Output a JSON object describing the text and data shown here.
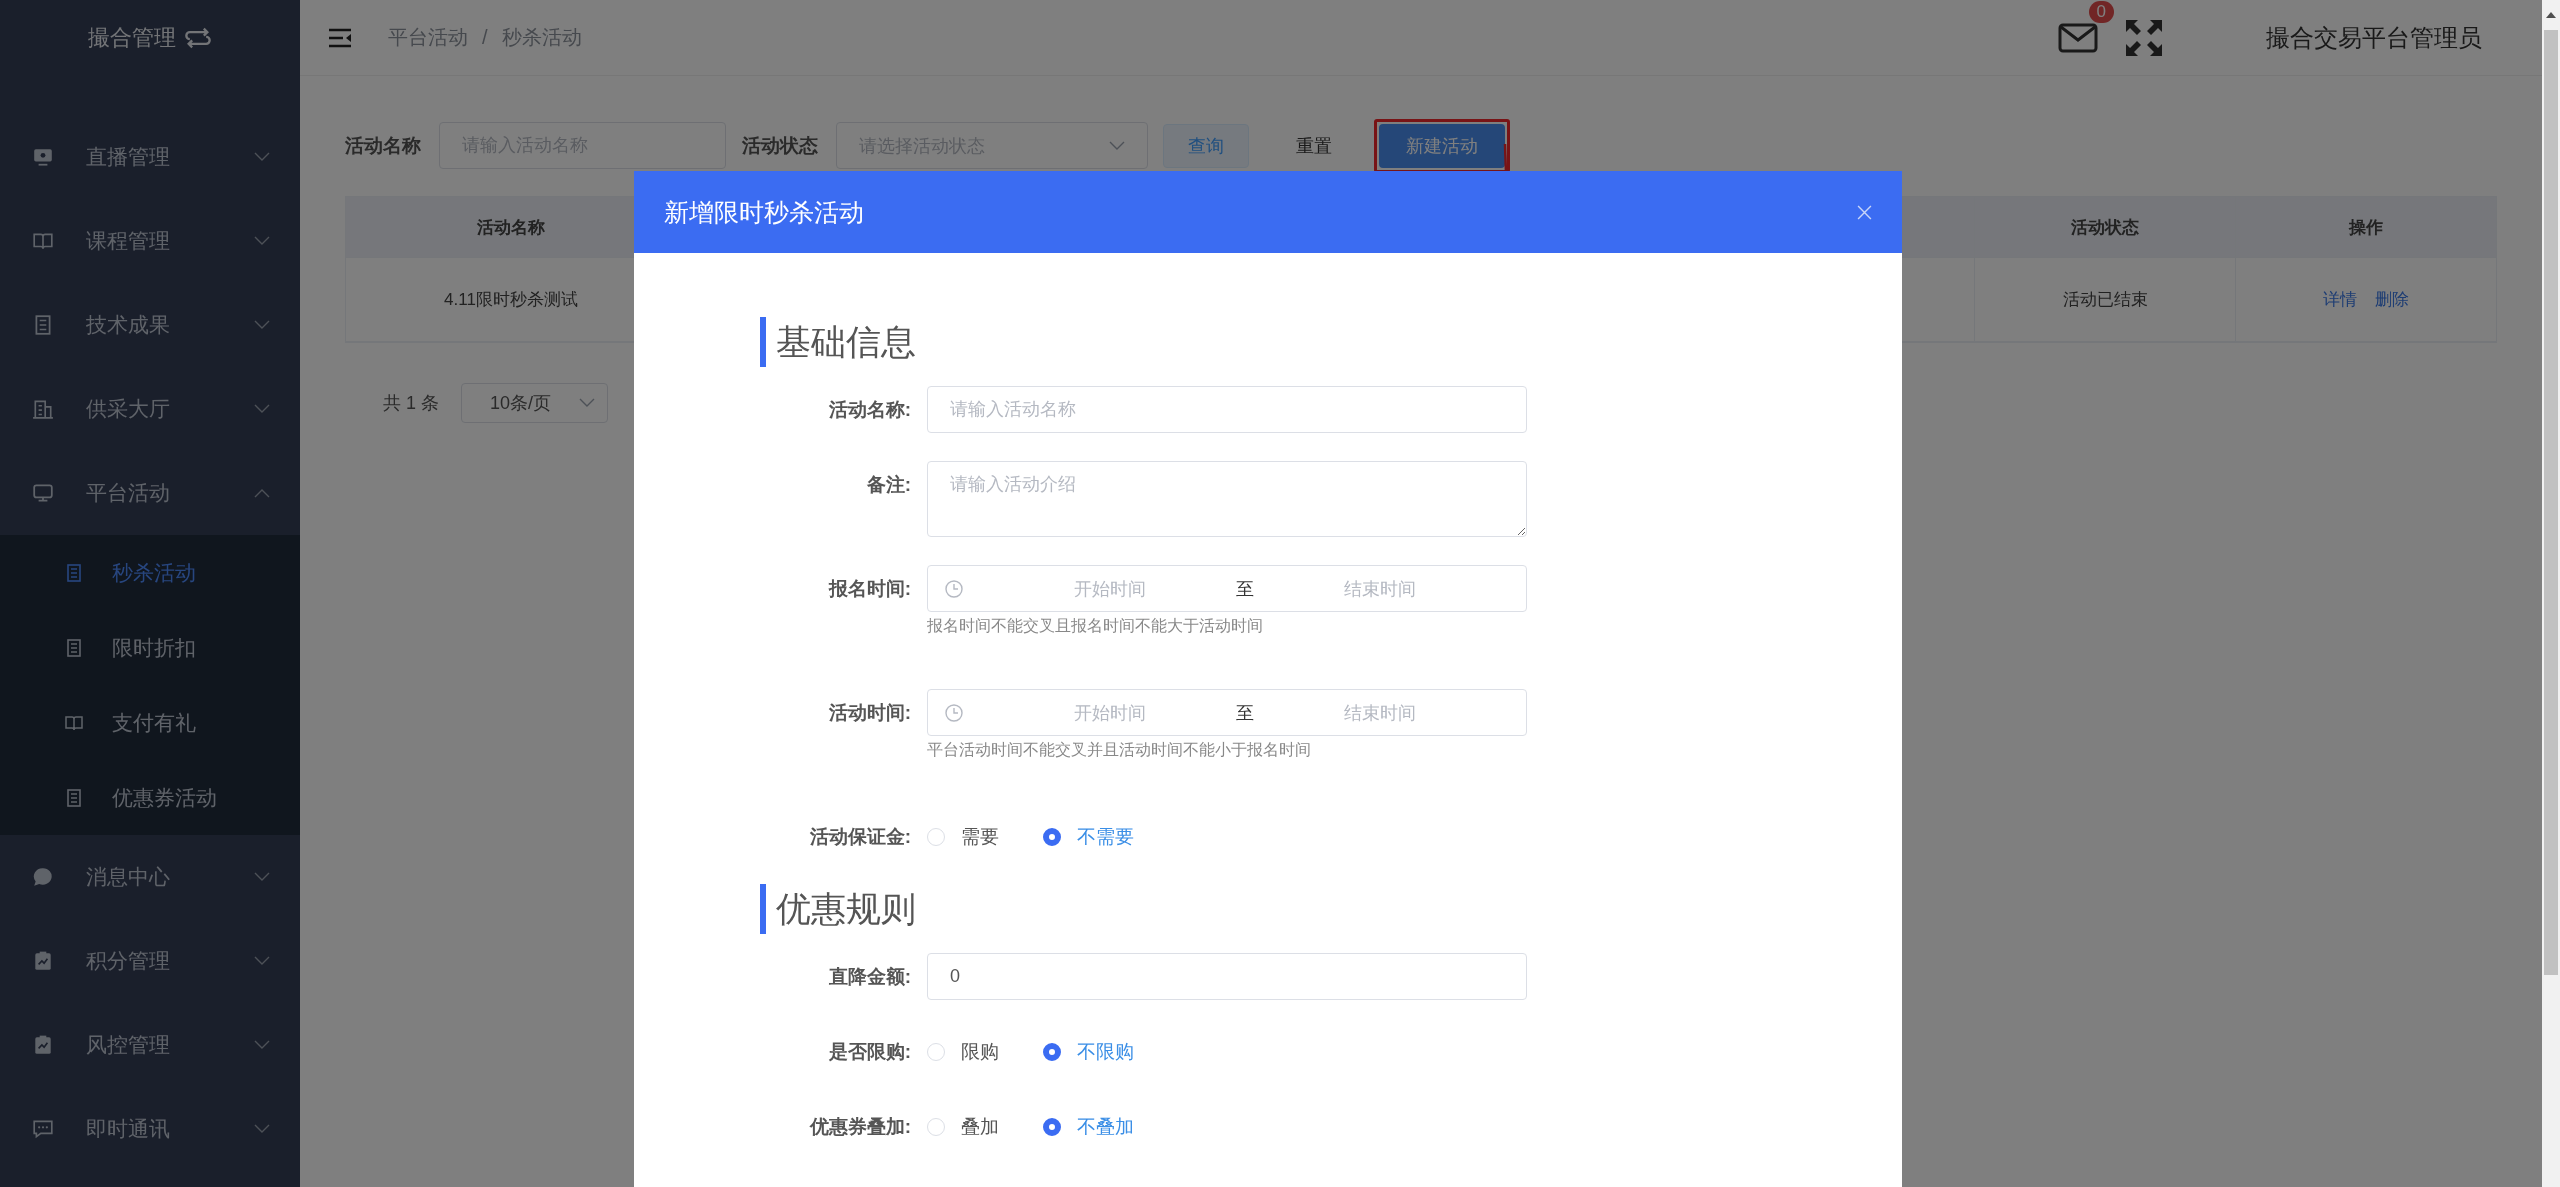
{
  "sidebar": {
    "title": "撮合管理",
    "items": [
      {
        "label": "直播管理",
        "expanded": false
      },
      {
        "label": "课程管理",
        "expanded": false
      },
      {
        "label": "技术成果",
        "expanded": false
      },
      {
        "label": "供采大厅",
        "expanded": false
      },
      {
        "label": "平台活动",
        "expanded": true,
        "children": [
          {
            "label": "秒杀活动",
            "selected": true
          },
          {
            "label": "限时折扣",
            "selected": false
          },
          {
            "label": "支付有礼",
            "selected": false
          },
          {
            "label": "优惠券活动",
            "selected": false
          }
        ]
      },
      {
        "label": "消息中心",
        "expanded": false
      },
      {
        "label": "积分管理",
        "expanded": false
      },
      {
        "label": "风控管理",
        "expanded": false
      },
      {
        "label": "即时通讯",
        "expanded": false
      }
    ]
  },
  "header": {
    "breadcrumb": [
      "平台活动",
      "秒杀活动"
    ],
    "separator": "/",
    "notification_count": "0",
    "user_name": "撮合交易平台管理员"
  },
  "filters": [
    {
      "kind": "input",
      "label": "活动名称",
      "placeholder": "请输入活动名称"
    },
    {
      "kind": "select",
      "label": "活动状态",
      "placeholder": "请选择活动状态"
    }
  ],
  "buttons": [
    {
      "kind": "plain",
      "label": "查询",
      "highlighted": false
    },
    {
      "kind": "default",
      "label": "重置",
      "highlighted": false
    },
    {
      "kind": "primary",
      "label": "新建活动",
      "highlighted": true
    }
  ],
  "table": {
    "columns": [
      "活动名称",
      "活动状态",
      "操作"
    ],
    "rows": [
      {
        "cells": [
          "4.11限时秒杀测试",
          "活动已结束"
        ],
        "actions": [
          "详情",
          "删除"
        ]
      }
    ]
  },
  "pagination": {
    "total": "共 1 条",
    "page_size": "10条/页"
  },
  "dialog": {
    "title": "新增限时秒杀活动",
    "sections": [
      {
        "title": "基础信息",
        "fields": [
          {
            "kind": "input",
            "label": "活动名称:",
            "placeholder": "请输入活动名称"
          },
          {
            "kind": "textarea",
            "label": "备注:",
            "placeholder": "请输入活动介绍"
          },
          {
            "kind": "daterange",
            "label": "报名时间:",
            "start_placeholder": "开始时间",
            "separator": "至",
            "end_placeholder": "结束时间",
            "hint": "报名时间不能交叉且报名时间不能大于活动时间"
          },
          {
            "kind": "daterange",
            "label": "活动时间:",
            "start_placeholder": "开始时间",
            "separator": "至",
            "end_placeholder": "结束时间",
            "hint": "平台活动时间不能交叉并且活动时间不能小于报名时间"
          },
          {
            "kind": "radio",
            "label": "活动保证金:",
            "options": [
              {
                "label": "需要",
                "selected": false
              },
              {
                "label": "不需要",
                "selected": true
              }
            ]
          }
        ]
      },
      {
        "title": "优惠规则",
        "fields": [
          {
            "kind": "input",
            "label": "直降金额:",
            "value": "0"
          },
          {
            "kind": "radio",
            "label": "是否限购:",
            "options": [
              {
                "label": "限购",
                "selected": false
              },
              {
                "label": "不限购",
                "selected": true
              }
            ]
          },
          {
            "kind": "radio",
            "label": "优惠券叠加:",
            "options": [
              {
                "label": "叠加",
                "selected": false
              },
              {
                "label": "不叠加",
                "selected": true
              }
            ]
          }
        ]
      }
    ]
  }
}
